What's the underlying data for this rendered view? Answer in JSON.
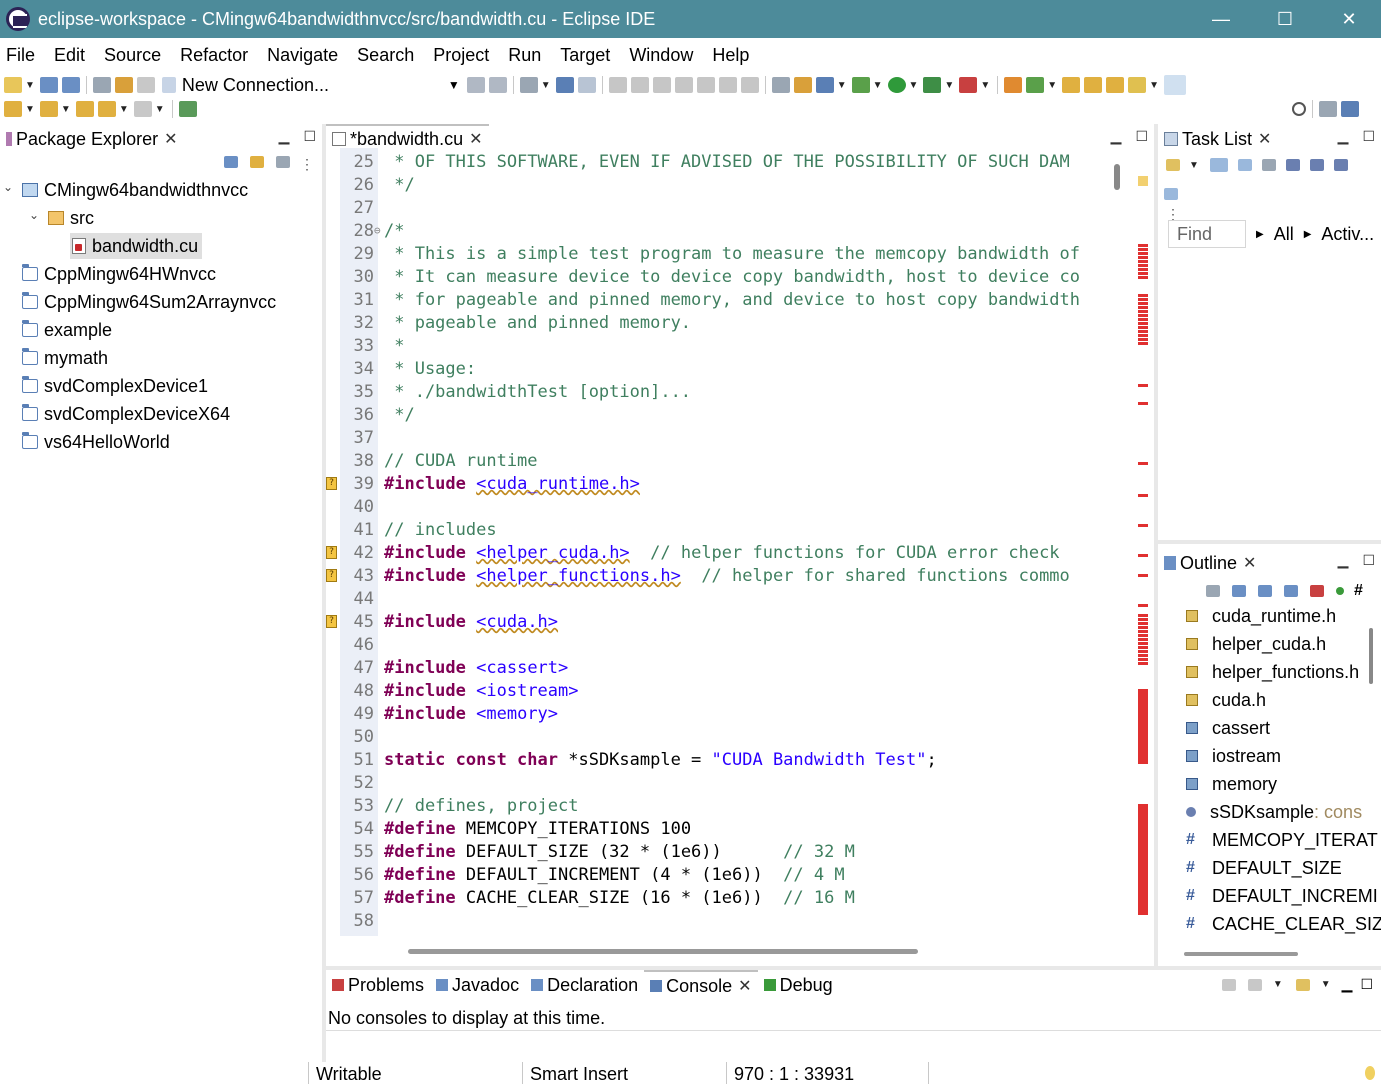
{
  "window": {
    "title": "eclipse-workspace - CMingw64bandwidthnvcc/src/bandwidth.cu - Eclipse IDE",
    "minimize": "—",
    "maximize": "☐",
    "close": "✕"
  },
  "menu": [
    "File",
    "Edit",
    "Source",
    "Refactor",
    "Navigate",
    "Search",
    "Project",
    "Run",
    "Target",
    "Window",
    "Help"
  ],
  "toolbar": {
    "connection": "New Connection..."
  },
  "package_explorer": {
    "tab": "Package Explorer",
    "items": [
      {
        "label": "CMingw64bandwidthnvcc",
        "level": 0,
        "expanded": true,
        "type": "project"
      },
      {
        "label": "src",
        "level": 1,
        "expanded": true,
        "type": "srcfolder"
      },
      {
        "label": "bandwidth.cu",
        "level": 2,
        "type": "file",
        "selected": true
      },
      {
        "label": "CppMingw64HWnvcc",
        "level": 0,
        "type": "folder"
      },
      {
        "label": "CppMingw64Sum2Arraynvcc",
        "level": 0,
        "type": "folder"
      },
      {
        "label": "example",
        "level": 0,
        "type": "folder"
      },
      {
        "label": "mymath",
        "level": 0,
        "type": "folder"
      },
      {
        "label": "svdComplexDevice1",
        "level": 0,
        "type": "folder"
      },
      {
        "label": "svdComplexDeviceX64",
        "level": 0,
        "type": "folder"
      },
      {
        "label": "vs64HelloWorld",
        "level": 0,
        "type": "folder"
      }
    ]
  },
  "editor": {
    "tab": "*bandwidth.cu",
    "lines": [
      {
        "n": "25",
        "text": " * OF THIS SOFTWARE, EVEN IF ADVISED OF THE POSSIBILITY OF SUCH DAM",
        "type": "comment"
      },
      {
        "n": "26",
        "text": " */",
        "type": "comment"
      },
      {
        "n": "27",
        "text": "",
        "type": "plain"
      },
      {
        "n": "28",
        "text": "/*",
        "type": "comment"
      },
      {
        "n": "29",
        "text": " * This is a simple test program to measure the memcopy bandwidth of",
        "type": "comment"
      },
      {
        "n": "30",
        "text": " * It can measure device to device copy bandwidth, host to device co",
        "type": "comment"
      },
      {
        "n": "31",
        "text": " * for pageable and pinned memory, and device to host copy bandwidth",
        "type": "comment"
      },
      {
        "n": "32",
        "text": " * pageable and pinned memory.",
        "type": "comment"
      },
      {
        "n": "33",
        "text": " *",
        "type": "comment"
      },
      {
        "n": "34",
        "text": " * Usage:",
        "type": "comment"
      },
      {
        "n": "35",
        "text": " * ./bandwidthTest [option]...",
        "type": "comment"
      },
      {
        "n": "36",
        "text": " */",
        "type": "comment"
      },
      {
        "n": "37",
        "text": "",
        "type": "plain"
      },
      {
        "n": "38",
        "text": "// CUDA runtime",
        "type": "comment"
      },
      {
        "n": "39",
        "kw": "#include",
        "inc": "<cuda_runtime.h>",
        "tail": "",
        "type": "include",
        "warn": true
      },
      {
        "n": "40",
        "text": "",
        "type": "plain"
      },
      {
        "n": "41",
        "text": "// includes",
        "type": "comment"
      },
      {
        "n": "42",
        "kw": "#include",
        "inc": "<helper_cuda.h>",
        "tail": "  // helper functions for CUDA error check",
        "type": "include",
        "warn": true
      },
      {
        "n": "43",
        "kw": "#include",
        "inc": "<helper_functions.h>",
        "tail": "  // helper for shared functions commo",
        "type": "include",
        "warn": true
      },
      {
        "n": "44",
        "text": "",
        "type": "plain"
      },
      {
        "n": "45",
        "kw": "#include",
        "inc": "<cuda.h>",
        "tail": "",
        "type": "include",
        "warn": true
      },
      {
        "n": "46",
        "text": "",
        "type": "plain"
      },
      {
        "n": "47",
        "kw": "#include",
        "inc": "<cassert>",
        "tail": "",
        "type": "include"
      },
      {
        "n": "48",
        "kw": "#include",
        "inc": "<iostream>",
        "tail": "",
        "type": "include"
      },
      {
        "n": "49",
        "kw": "#include",
        "inc": "<memory>",
        "tail": "",
        "type": "include"
      },
      {
        "n": "50",
        "text": "",
        "type": "plain"
      },
      {
        "n": "51",
        "kw": "static const char",
        "mid": " *sSDKsample = ",
        "str": "\"CUDA Bandwidth Test\"",
        "end": ";",
        "type": "decl"
      },
      {
        "n": "52",
        "text": "",
        "type": "plain"
      },
      {
        "n": "53",
        "text": "// defines, project",
        "type": "comment"
      },
      {
        "n": "54",
        "kw": "#define",
        "mid": " MEMCOPY_ITERATIONS 100",
        "tail": "",
        "type": "define"
      },
      {
        "n": "55",
        "kw": "#define",
        "mid": " DEFAULT_SIZE (32 * (1e6))",
        "tail": "      // 32 M",
        "type": "define"
      },
      {
        "n": "56",
        "kw": "#define",
        "mid": " DEFAULT_INCREMENT (4 * (1e6))",
        "tail": "  // 4 M",
        "type": "define"
      },
      {
        "n": "57",
        "kw": "#define",
        "mid": " CACHE_CLEAR_SIZE (16 * (1e6))",
        "tail": "  // 16 M",
        "type": "define"
      },
      {
        "n": "58",
        "text": "",
        "type": "plain"
      }
    ]
  },
  "task_list": {
    "tab": "Task List",
    "find_placeholder": "Find",
    "all": "All",
    "activate": "Activ..."
  },
  "outline": {
    "tab": "Outline",
    "items": [
      {
        "label": "cuda_runtime.h",
        "kind": "include"
      },
      {
        "label": "helper_cuda.h",
        "kind": "include"
      },
      {
        "label": "helper_functions.h",
        "kind": "include"
      },
      {
        "label": "cuda.h",
        "kind": "include"
      },
      {
        "label": "cassert",
        "kind": "include2"
      },
      {
        "label": "iostream",
        "kind": "include2"
      },
      {
        "label": "memory",
        "kind": "include2"
      },
      {
        "label": "sSDKsample",
        "suffix": " : cons",
        "kind": "var"
      },
      {
        "label": "MEMCOPY_ITERAT",
        "kind": "macro"
      },
      {
        "label": "DEFAULT_SIZE",
        "kind": "macro"
      },
      {
        "label": "DEFAULT_INCREMI",
        "kind": "macro"
      },
      {
        "label": "CACHE_CLEAR_SIZ",
        "kind": "macro"
      }
    ]
  },
  "bottom_tabs": [
    "Problems",
    "Javadoc",
    "Declaration",
    "Console",
    "Debug"
  ],
  "console_message": "No consoles to display at this time.",
  "status": {
    "writable": "Writable",
    "insert": "Smart Insert",
    "position": "970 : 1 : 33931"
  }
}
